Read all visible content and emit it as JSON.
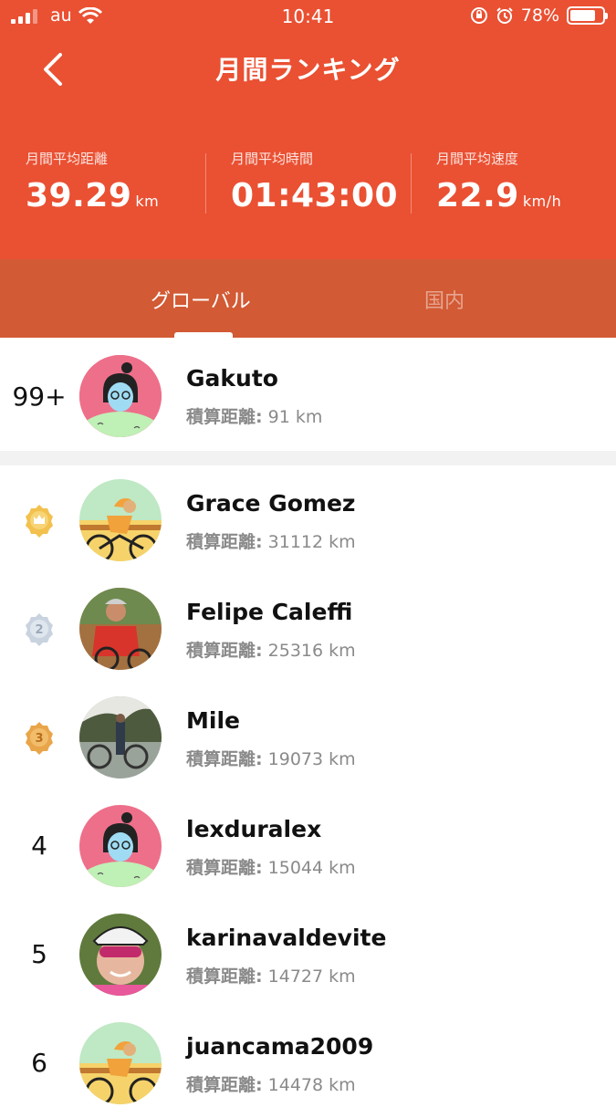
{
  "status_bar": {
    "carrier": "au",
    "time": "10:41",
    "battery": "78%",
    "battery_level": 0.78
  },
  "header": {
    "title": "月間ランキング",
    "stats": [
      {
        "label": "月間平均距離",
        "value": "39.29",
        "unit": "km"
      },
      {
        "label": "月間平均時間",
        "value": "01:43:00",
        "unit": ""
      },
      {
        "label": "月間平均速度",
        "value": "22.9",
        "unit": "km/h"
      }
    ]
  },
  "tabs": [
    {
      "label": "グローバル",
      "active": true
    },
    {
      "label": "国内",
      "active": false
    }
  ],
  "my_rank": {
    "rank": "99+",
    "name": "Gakuto",
    "distance_label": "積算距離:",
    "distance": "91 km"
  },
  "ranking": [
    {
      "rank": "1",
      "name": "Grace  Gomez",
      "distance_label": "積算距離:",
      "distance": "31112 km"
    },
    {
      "rank": "2",
      "name": "Felipe Caleffi",
      "distance_label": "積算距離:",
      "distance": "25316 km"
    },
    {
      "rank": "3",
      "name": "Mile",
      "distance_label": "積算距離:",
      "distance": "19073 km"
    },
    {
      "rank": "4",
      "name": "lexduralex",
      "distance_label": "積算距離:",
      "distance": "15044 km"
    },
    {
      "rank": "5",
      "name": "karinavaldevite",
      "distance_label": "積算距離:",
      "distance": "14727 km"
    },
    {
      "rank": "6",
      "name": "juancama2009",
      "distance_label": "積算距離:",
      "distance": "14478 km"
    }
  ],
  "colors": {
    "accent": "#ea5032",
    "tab_bar": "#d25a34",
    "gold": "#f2c14e",
    "silver": "#c9d3df",
    "bronze": "#e9a54a"
  }
}
